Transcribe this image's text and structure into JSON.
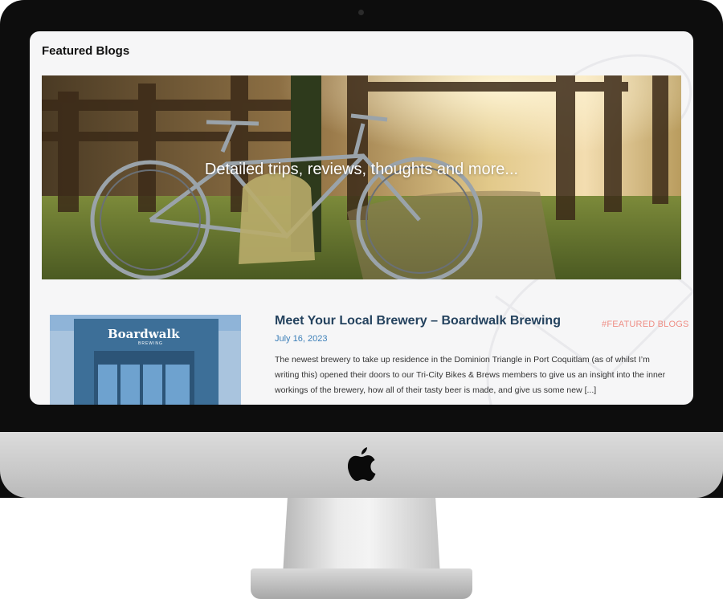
{
  "page": {
    "title": "Featured Blogs"
  },
  "hero": {
    "tagline": "Detailed trips, reviews, thoughts and more..."
  },
  "post": {
    "title": "Meet Your Local Brewery – Boardwalk Brewing",
    "date": "July 16, 2023",
    "tag": "#FEATURED BLOGS",
    "excerpt": "The newest brewery to take up residence in the Dominion Triangle in Port Coquitlam (as of whilst I’m writing this) opened their doors to our Tri-City Bikes & Brews members to give us an insight into the inner workings of the brewery, how all of their tasty beer is made, and give us some new [...]",
    "thumbnail": {
      "sign": "Boardwalk",
      "sign_sub": "BREWING"
    }
  },
  "icons": {
    "device_logo": "apple-logo-icon",
    "camera": "camera-dot"
  },
  "colors": {
    "post_title": "#24425e",
    "post_date": "#3c7fb8",
    "tag": "#ef8f86",
    "screen_bg": "#f6f6f7"
  }
}
